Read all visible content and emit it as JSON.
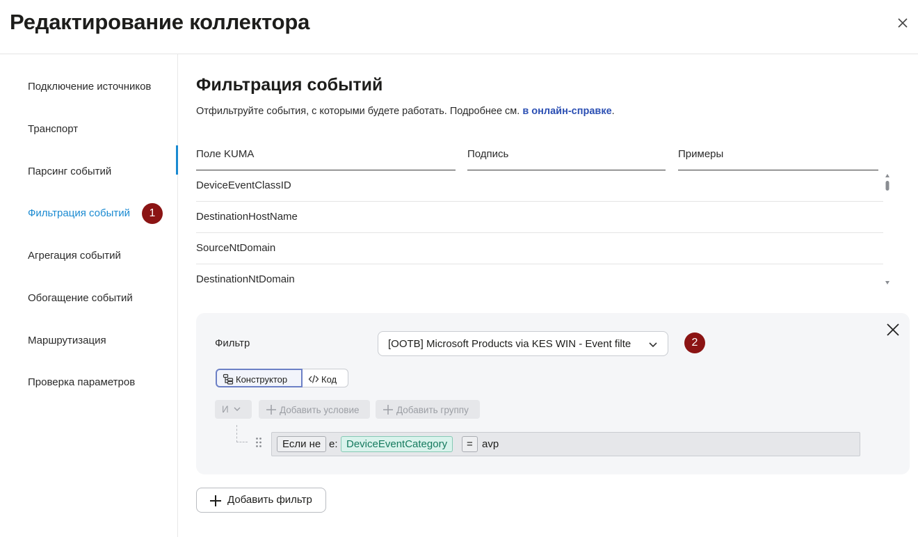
{
  "dialog": {
    "title": "Редактирование коллектора"
  },
  "sidebar": {
    "items": [
      {
        "label": "Подключение источников"
      },
      {
        "label": "Транспорт"
      },
      {
        "label": "Парсинг событий"
      },
      {
        "label": "Фильтрация событий",
        "active": true,
        "badge": "1"
      },
      {
        "label": "Агрегация событий"
      },
      {
        "label": "Обогащение событий"
      },
      {
        "label": "Маршрутизация"
      },
      {
        "label": "Проверка параметров"
      }
    ]
  },
  "main": {
    "title": "Фильтрация событий",
    "description": "Отфильтруйте события, с которыми будете работать. Подробнее см.",
    "help_link": "в онлайн-справке",
    "description_end": ".",
    "table": {
      "columns": [
        "Поле KUMA",
        "Подпись",
        "Примеры"
      ],
      "rows": [
        "DeviceEventClassID",
        "DestinationHostName",
        "SourceNtDomain",
        "DestinationNtDomain"
      ]
    }
  },
  "filter": {
    "label": "Фильтр",
    "selected": "[OOTB] Microsoft Products via KES WIN - Event filte",
    "badge": "2",
    "mode_tabs": [
      "Конструктор",
      "Код"
    ],
    "logic_operator": "И",
    "add_condition": "Добавить условие",
    "add_group": "Добавить группу",
    "condition": {
      "negation": "Если не",
      "prefix": "e:",
      "field": "DeviceEventCategory",
      "operator": "=",
      "value": "avp"
    }
  },
  "add_filter_label": "Добавить фильтр",
  "colors": {
    "accent": "#1a8ad1",
    "badge": "#8b1414",
    "link": "#2b4fb3",
    "field_token": "#d9f3ec"
  }
}
